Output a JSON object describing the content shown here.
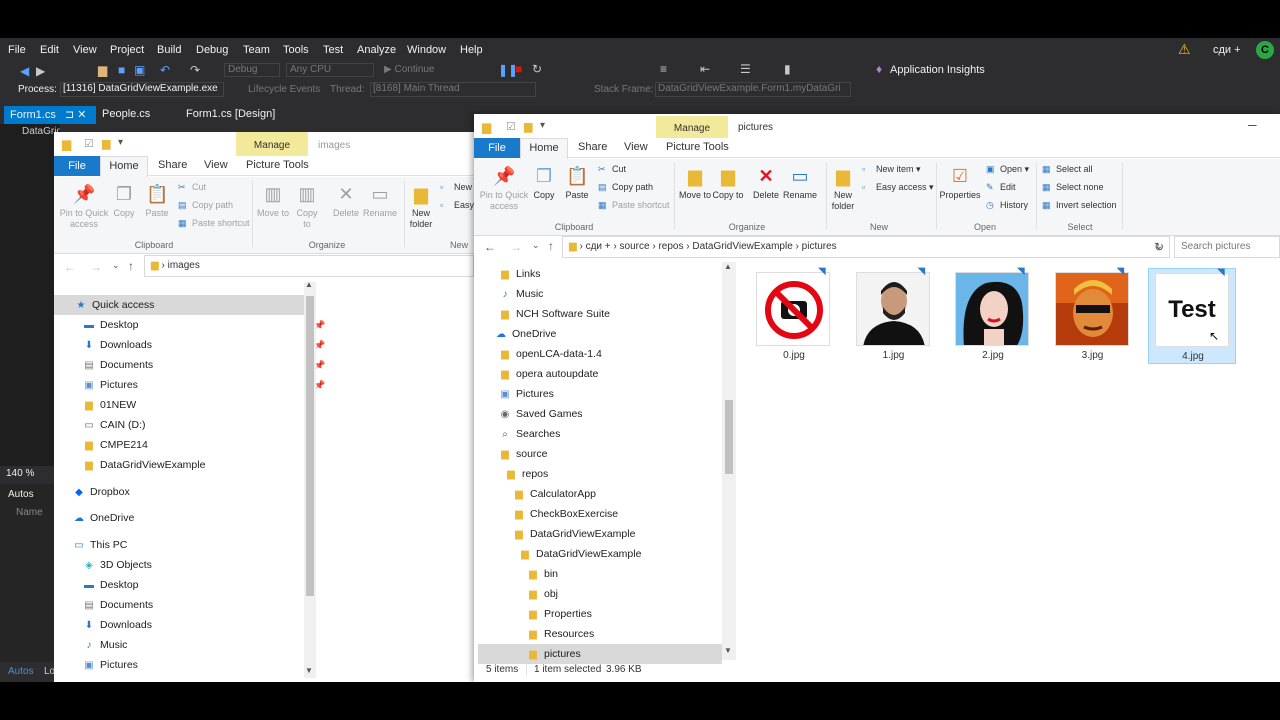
{
  "vs": {
    "menu": [
      "File",
      "Edit",
      "View",
      "Project",
      "Build",
      "Debug",
      "Team",
      "Tools",
      "Test",
      "Analyze",
      "Window",
      "Help"
    ],
    "user": "сди +",
    "user_initial": "C",
    "config": "Debug",
    "platform": "Any CPU",
    "continue_label": "Continue",
    "app_insights": "Application Insights",
    "process_label": "Process:",
    "process_value": "[11316] DataGridViewExample.exe",
    "lifecycle": "Lifecycle Events",
    "thread_label": "Thread:",
    "thread_value": "[8168] Main Thread",
    "stackframe_label": "Stack Frame:",
    "stackframe_value": "DataGridViewExample.Form1.myDataGri",
    "tabs": [
      "Form1.cs",
      "People.cs",
      "Form1.cs [Design]"
    ],
    "side_snippet": "DataGridViewExample",
    "zoom": "140 %",
    "autos": "Autos",
    "name_col": "Name",
    "autos_tab": "Autos",
    "lo_tab": "Lo"
  },
  "win1": {
    "manage": "Manage",
    "title": "images",
    "tabs": [
      "File",
      "Home",
      "Share",
      "View",
      "Picture Tools"
    ],
    "clipboard": {
      "pin": "Pin to Quick access",
      "copy": "Copy",
      "paste": "Paste",
      "cut": "Cut",
      "copy_path": "Copy path",
      "paste_shortcut": "Paste shortcut",
      "label": "Clipboard"
    },
    "organize": {
      "move": "Move to",
      "copy": "Copy to",
      "delete": "Delete",
      "rename": "Rename",
      "label": "Organize"
    },
    "new": {
      "folder": "New folder",
      "item": "New",
      "easy": "Easy",
      "label": "New"
    },
    "address": "images",
    "nav": [
      {
        "label": "Quick access",
        "icon": "star"
      },
      {
        "label": "Desktop",
        "icon": "desktop"
      },
      {
        "label": "Downloads",
        "icon": "download"
      },
      {
        "label": "Documents",
        "icon": "document"
      },
      {
        "label": "Pictures",
        "icon": "pictures"
      },
      {
        "label": "01NEW",
        "icon": "folder"
      },
      {
        "label": "CAIN (D:)",
        "icon": "drive"
      },
      {
        "label": "CMPE214",
        "icon": "folder"
      },
      {
        "label": "DataGridViewExample",
        "icon": "folder"
      },
      {
        "label": "Dropbox",
        "icon": "dropbox"
      },
      {
        "label": "OneDrive",
        "icon": "cloud"
      },
      {
        "label": "This PC",
        "icon": "pc"
      },
      {
        "label": "3D Objects",
        "icon": "cube"
      },
      {
        "label": "Desktop",
        "icon": "desktop"
      },
      {
        "label": "Documents",
        "icon": "document"
      },
      {
        "label": "Downloads",
        "icon": "download"
      },
      {
        "label": "Music",
        "icon": "music"
      },
      {
        "label": "Pictures",
        "icon": "pictures"
      }
    ]
  },
  "win2": {
    "manage": "Manage",
    "title": "pictures",
    "tabs": [
      "File",
      "Home",
      "Share",
      "View",
      "Picture Tools"
    ],
    "clipboard": {
      "pin": "Pin to Quick access",
      "copy": "Copy",
      "paste": "Paste",
      "cut": "Cut",
      "copy_path": "Copy path",
      "paste_shortcut": "Paste shortcut",
      "label": "Clipboard"
    },
    "organize": {
      "move": "Move to",
      "copy": "Copy to",
      "delete": "Delete",
      "rename": "Rename",
      "label": "Organize"
    },
    "new": {
      "folder": "New folder",
      "new_item": "New item",
      "easy_access": "Easy access",
      "label": "New"
    },
    "open": {
      "properties": "Properties",
      "open": "Open",
      "edit": "Edit",
      "history": "History",
      "label": "Open"
    },
    "select": {
      "all": "Select all",
      "none": "Select none",
      "invert": "Invert selection",
      "label": "Select"
    },
    "breadcrumb": [
      "сди +",
      "source",
      "repos",
      "DataGridViewExample",
      "pictures"
    ],
    "search_placeholder": "Search pictures",
    "nav": [
      {
        "label": "Links",
        "icon": "link"
      },
      {
        "label": "Music",
        "icon": "music"
      },
      {
        "label": "NCH Software Suite",
        "icon": "folder"
      },
      {
        "label": "OneDrive",
        "icon": "cloud"
      },
      {
        "label": "openLCA-data-1.4",
        "icon": "folder"
      },
      {
        "label": "opera autoupdate",
        "icon": "folder"
      },
      {
        "label": "Pictures",
        "icon": "pictures"
      },
      {
        "label": "Saved Games",
        "icon": "games"
      },
      {
        "label": "Searches",
        "icon": "search"
      },
      {
        "label": "source",
        "icon": "folder"
      },
      {
        "label": "repos",
        "icon": "folder"
      },
      {
        "label": "CalculatorApp",
        "icon": "folder"
      },
      {
        "label": "CheckBoxExercise",
        "icon": "folder"
      },
      {
        "label": "DataGridViewExample",
        "icon": "folder"
      },
      {
        "label": "DataGridViewExample",
        "icon": "folder"
      },
      {
        "label": "bin",
        "icon": "folder"
      },
      {
        "label": "obj",
        "icon": "folder"
      },
      {
        "label": "Properties",
        "icon": "folder"
      },
      {
        "label": "Resources",
        "icon": "folder"
      },
      {
        "label": "pictures",
        "icon": "folder"
      }
    ],
    "files": [
      {
        "name": "0.jpg",
        "kind": "no-camera"
      },
      {
        "name": "1.jpg",
        "kind": "person"
      },
      {
        "name": "2.jpg",
        "kind": "painting"
      },
      {
        "name": "3.jpg",
        "kind": "game"
      },
      {
        "name": "4.jpg",
        "kind": "text",
        "text": "Test"
      }
    ],
    "status_items": "5 items",
    "status_selected": "1 item selected",
    "status_size": "3.96 KB"
  }
}
